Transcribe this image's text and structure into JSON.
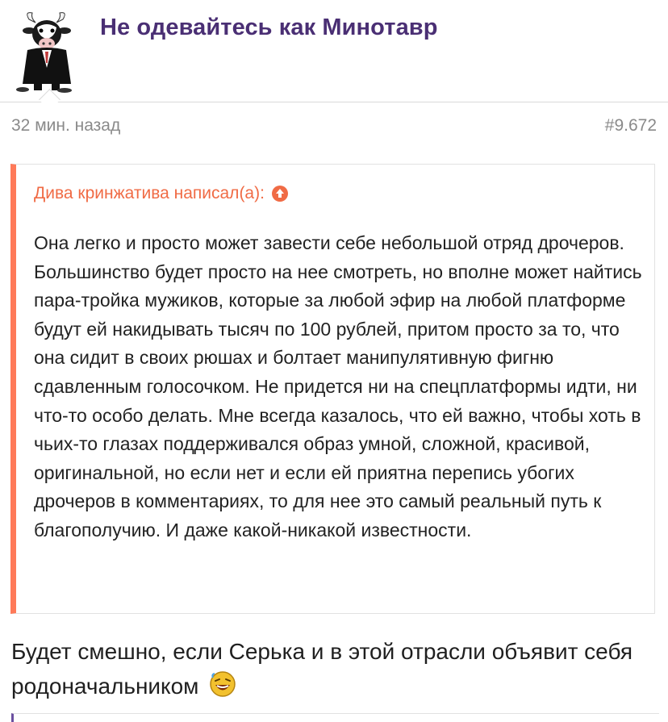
{
  "post": {
    "author": "Не одевайтесь как Минотавр",
    "avatar_icon": "minotaur-avatar-icon",
    "time": "32 мин. назад",
    "number": "#9.672",
    "quote": {
      "author_line": "Дива кринжатива написал(а):",
      "jump_icon": "arrow-up-circle-icon",
      "text": "Она легко и просто может завести себе небольшой отряд дрочеров. Большинство будет просто на нее смотреть, но вполне может найтись пара-тройка мужиков, которые за любой эфир на любой платформе будут ей накидывать тысяч по 100 рублей, притом просто за то, что она сидит в своих рюшах и болтает манипулятивную фигню сдавленным голосочком. Не придется ни на спецплатформы идти, ни что-то особо делать. Мне всегда казалось, что ей важно, чтобы хоть в чьих-то глазах поддерживался образ умной, сложной, красивой, оригинальной, но если нет и если ей приятна перепись убогих дрочеров в комментариях, то для нее это самый реальный путь к благополучию. И даже какой-никакой известности."
    },
    "body_text": "Будет смешно, если Серька и в этой отрасли объявит себя родоначальником",
    "emoji_icon": "laughing-smiley-icon"
  },
  "colors": {
    "author": "#4a2f74",
    "quote_accent": "#ff7a59",
    "quote_author": "#f06b45",
    "meta": "#8a8a8a"
  }
}
